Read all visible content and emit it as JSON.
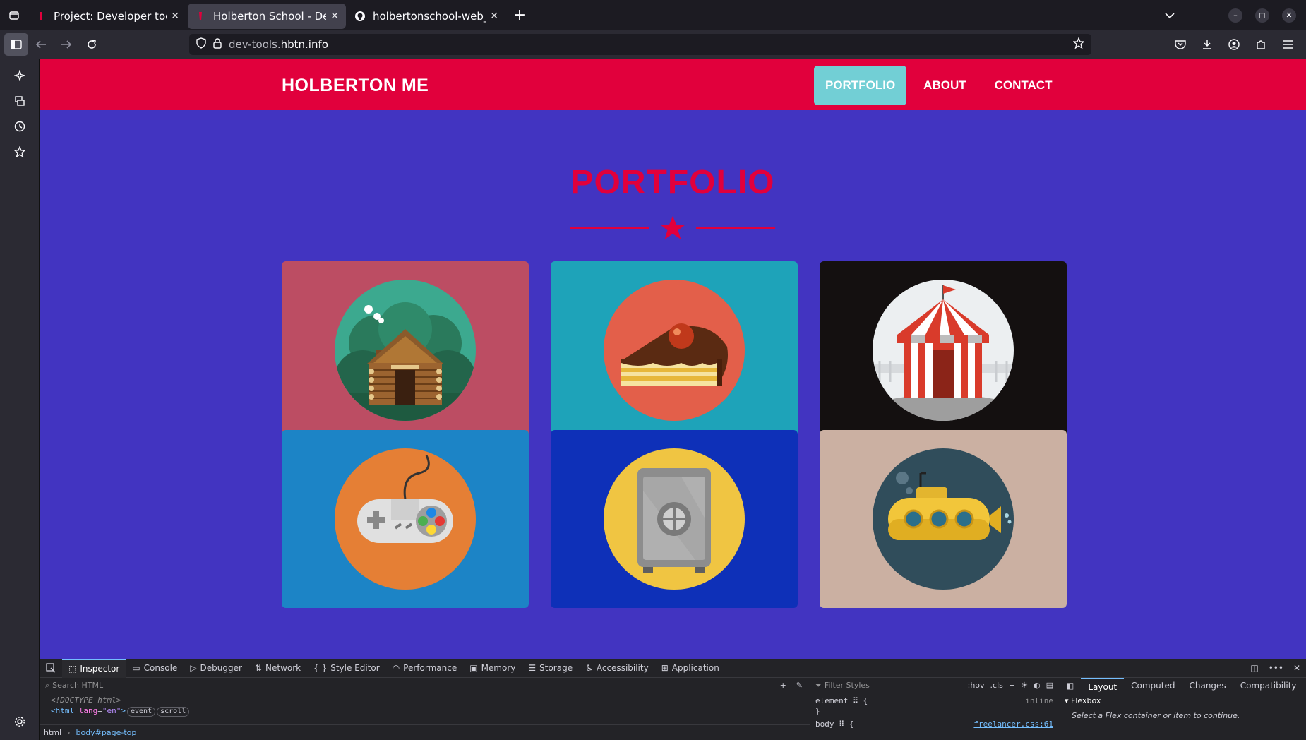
{
  "browser": {
    "tabs": [
      {
        "title": "Project: Developer tools |",
        "active": false
      },
      {
        "title": "Holberton School - Devel",
        "active": true
      },
      {
        "title": "holbertonschool-web_fro",
        "active": false
      }
    ],
    "url_dim": "dev-tools.",
    "url_domain": "hbtn.info"
  },
  "site": {
    "brand": "HOLBERTON ME",
    "nav": [
      {
        "label": "PORTFOLIO",
        "active": true
      },
      {
        "label": "ABOUT",
        "active": false
      },
      {
        "label": "CONTACT",
        "active": false
      }
    ],
    "section_title": "PORTFOLIO",
    "colors": {
      "header": "#e1003c",
      "body": "#4234c1",
      "active_nav": "#72cfd5"
    },
    "portfolio": [
      {
        "name": "cabin",
        "bg": "#bc4d63"
      },
      {
        "name": "cake",
        "bg": "#1ea3b9"
      },
      {
        "name": "circus",
        "bg": "#141010"
      },
      {
        "name": "game",
        "bg": "#1c84c6"
      },
      {
        "name": "safe",
        "bg": "#0e30b8"
      },
      {
        "name": "submarine",
        "bg": "#cbb0a2"
      }
    ]
  },
  "devtools": {
    "tabs": [
      "Inspector",
      "Console",
      "Debugger",
      "Network",
      "Style Editor",
      "Performance",
      "Memory",
      "Storage",
      "Accessibility",
      "Application"
    ],
    "search_placeholder": "Search HTML",
    "doctype": "<!DOCTYPE html>",
    "html_tag": "<html",
    "html_attr": "lang",
    "html_val": "\"en\"",
    "html_close": ">",
    "badges": [
      "event",
      "scroll"
    ],
    "breadcrumbs": [
      "html",
      "body#page-top"
    ],
    "filter_placeholder": "Filter Styles",
    "filter_tools": [
      ":hov",
      ".cls"
    ],
    "rule1_selector": "element",
    "rule1_source": "inline",
    "rule1_close": "}",
    "rule2_selector": "body",
    "rule2_source": "freelancer.css:61",
    "layout_tabs": [
      "Layout",
      "Computed",
      "Changes",
      "Compatibility"
    ],
    "flexbox_label": "Flexbox",
    "flexbox_msg": "Select a Flex container or item to continue."
  }
}
